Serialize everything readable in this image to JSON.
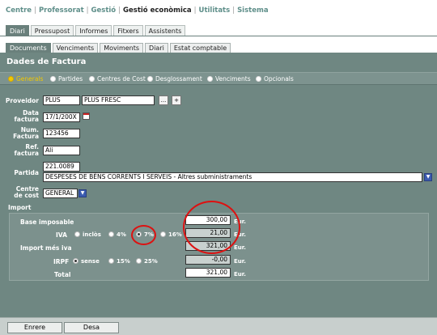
{
  "topnav": [
    "Centre",
    "Professorat",
    "Gestió",
    "Gestió econòmica",
    "Utilitats",
    "Sistema"
  ],
  "tabs1": [
    "Diari",
    "Pressupost",
    "Informes",
    "Fitxers",
    "Assistents"
  ],
  "tabs2": [
    "Documents",
    "Venciments",
    "Moviments",
    "Diari",
    "Estat comptable"
  ],
  "panel": {
    "title": "Dades de Factura",
    "options": [
      "Generals",
      "Partides",
      "Centres de Cost",
      "Desglossament",
      "Venciments",
      "Opcionals"
    ],
    "selected_option": "Generals"
  },
  "form": {
    "proveidor_label": "Proveidor",
    "proveidor_code": "PLUS",
    "proveidor_name": "PLUS FRESC",
    "ellipsis_btn": "...",
    "plus_btn": "+",
    "data_label": "Data factura",
    "data_value": "17/1/200X",
    "num_label": "Num. Factura",
    "num_value": "123456",
    "ref_label": "Ref. factura",
    "ref_value": "Ali",
    "partida_label": "Partida",
    "partida_code": "221.0089",
    "partida_desc": "DESPESES DE BÉNS CORRENTS I SERVEIS - Altres subministraments",
    "centre_label": "Centre de cost",
    "centre_value": "GENERAL"
  },
  "import": {
    "title": "Import",
    "base_label": "Base imposable",
    "base_value": "300,00",
    "iva_label": "IVA",
    "iva_options": [
      "inclòs",
      "4%",
      "7%",
      "16%"
    ],
    "iva_selected": "7%",
    "iva_value": "21,00",
    "mes_iva_label": "Import més iva",
    "mes_iva_value": "321,00",
    "irpf_label": "IRPF",
    "irpf_options": [
      "sense",
      "15%",
      "25%"
    ],
    "irpf_selected": "sense",
    "irpf_value": "-0,00",
    "total_label": "Total",
    "total_value": "321,00",
    "unit": "Eur."
  },
  "footer": {
    "back": "Enrere",
    "save": "Desa"
  },
  "colors": {
    "panel": "#6f8782",
    "accent": "#f2c800",
    "highlight_circle": "#dd1111"
  }
}
